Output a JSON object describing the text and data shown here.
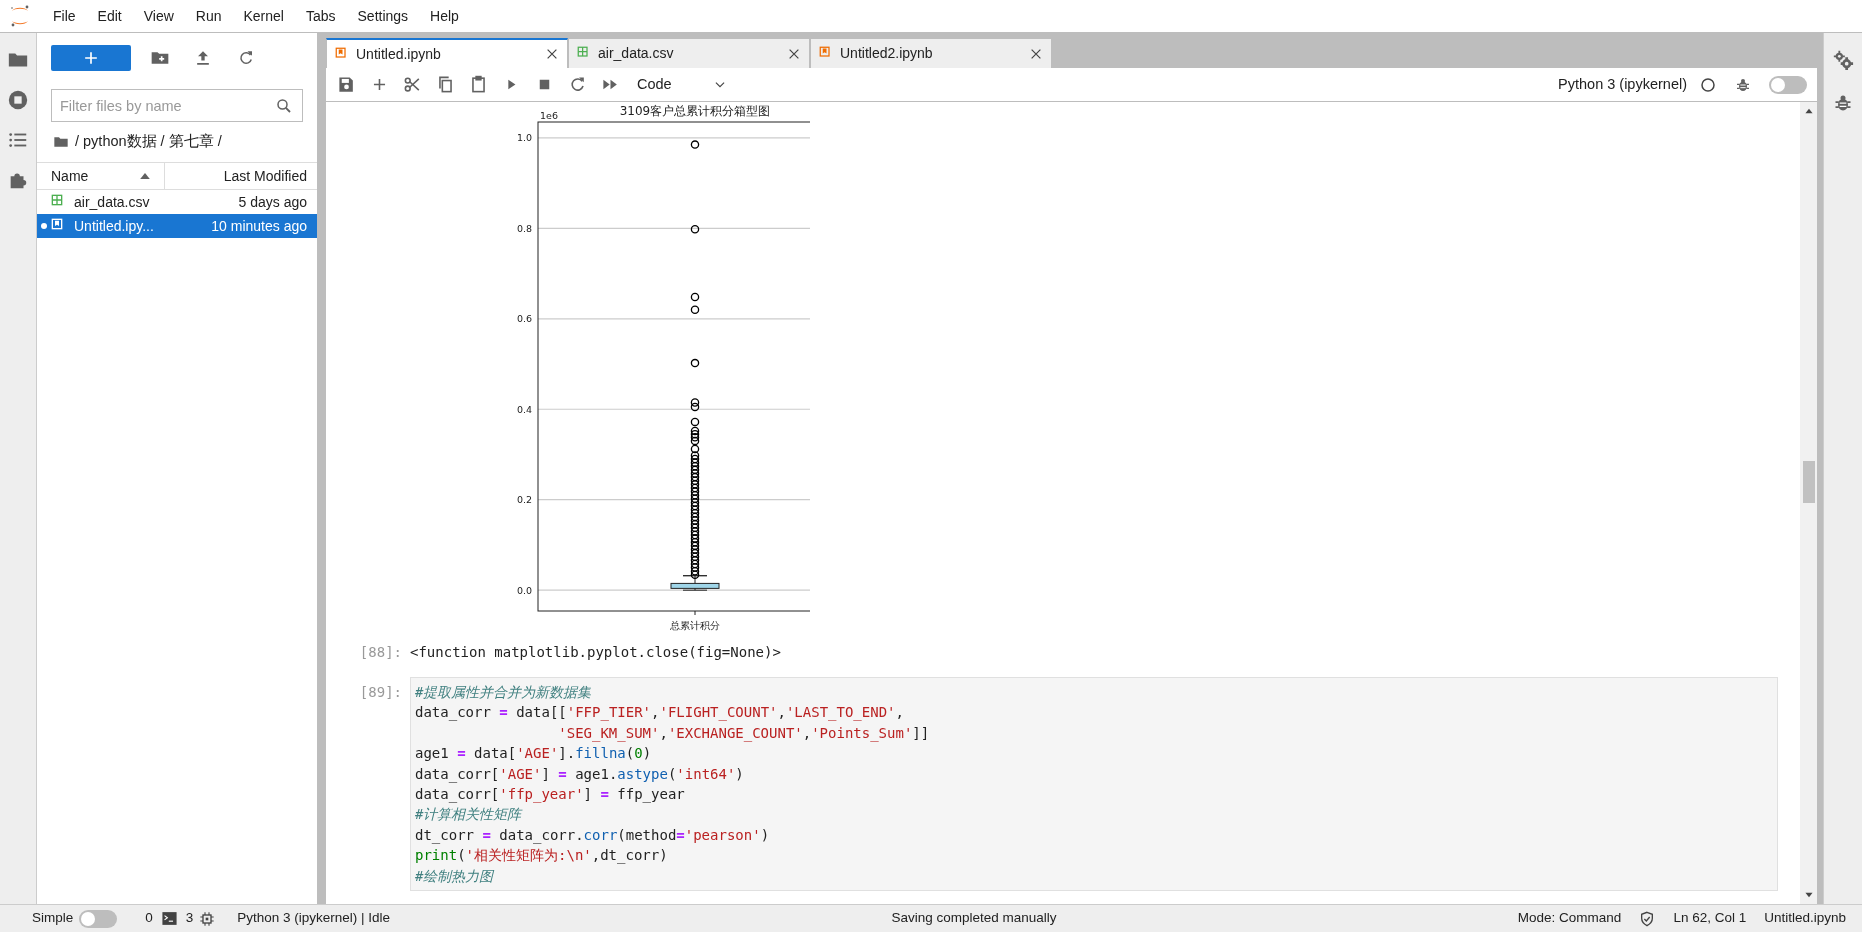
{
  "menu": [
    "File",
    "Edit",
    "View",
    "Run",
    "Kernel",
    "Tabs",
    "Settings",
    "Help"
  ],
  "file_browser": {
    "filter_placeholder": "Filter files by name",
    "breadcrumb": "/ python数据 / 第七章 /",
    "columns": [
      "Name",
      "Last Modified"
    ],
    "files": [
      {
        "name": "air_data.csv",
        "modified": "5 days ago",
        "kind": "csv",
        "selected": false,
        "running": false
      },
      {
        "name": "Untitled.ipy...",
        "modified": "10 minutes ago",
        "kind": "notebook",
        "selected": true,
        "running": true
      }
    ]
  },
  "tabs": [
    {
      "label": "Untitled.ipynb",
      "kind": "notebook",
      "selected": true
    },
    {
      "label": "air_data.csv",
      "kind": "csv",
      "selected": false
    },
    {
      "label": "Untitled2.ipynb",
      "kind": "notebook",
      "selected": false
    }
  ],
  "toolbar": {
    "cell_type": "Code",
    "kernel": "Python 3 (ipykernel)",
    "debugger_on": false
  },
  "output_chart": {
    "chart_data": {
      "type": "scatter",
      "title": "3109客户总累计积分箱型图",
      "ylabel": "1e6",
      "grid": true,
      "ylim": [
        -0.046,
        1.035
      ],
      "categories": [
        "总累计积分"
      ],
      "yticks": [
        {
          "value": 0,
          "label": "0.0"
        },
        {
          "value": 0.2,
          "label": "0.2"
        },
        {
          "value": 0.4,
          "label": "0.4"
        },
        {
          "value": 0.6,
          "label": "0.6"
        },
        {
          "value": 0.8,
          "label": "0.8"
        },
        {
          "value": 1,
          "label": "1.0"
        }
      ],
      "series": [
        {
          "color": "#000000",
          "values": [
            0.985
          ]
        },
        {
          "color": "#000000",
          "values": [
            0.798
          ]
        },
        {
          "color": "#000000",
          "values": [
            0.648
          ]
        },
        {
          "color": "#000000",
          "values": [
            0.62
          ]
        },
        {
          "color": "#000000",
          "values": [
            0.502
          ]
        },
        {
          "color": "#000000",
          "values": [
            0.415
          ]
        },
        {
          "color": "#000000",
          "values": [
            0.405
          ]
        },
        {
          "color": "#000000",
          "values": [
            0.372
          ]
        },
        {
          "color": "#000000",
          "values": [
            0.352
          ]
        },
        {
          "color": "#000000",
          "values": [
            0.345
          ]
        },
        {
          "color": "#000000",
          "values": [
            0.338
          ]
        },
        {
          "color": "#000000",
          "values": [
            0.33
          ]
        },
        {
          "color": "#000000",
          "values": [
            0.312
          ]
        },
        {
          "color": "#000000",
          "values": [
            0.298
          ]
        },
        {
          "color": "#000000",
          "values": [
            0.29
          ]
        },
        {
          "color": "#000000",
          "values": [
            0.282
          ]
        },
        {
          "color": "#000000",
          "values": [
            0.274
          ]
        },
        {
          "color": "#000000",
          "values": [
            0.266
          ]
        },
        {
          "color": "#000000",
          "values": [
            0.258
          ]
        },
        {
          "color": "#000000",
          "values": [
            0.25
          ]
        },
        {
          "color": "#000000",
          "values": [
            0.242
          ]
        },
        {
          "color": "#000000",
          "values": [
            0.234
          ]
        },
        {
          "color": "#000000",
          "values": [
            0.226
          ]
        },
        {
          "color": "#000000",
          "values": [
            0.218
          ]
        },
        {
          "color": "#000000",
          "values": [
            0.21
          ]
        },
        {
          "color": "#000000",
          "values": [
            0.202
          ]
        },
        {
          "color": "#000000",
          "values": [
            0.194
          ]
        },
        {
          "color": "#000000",
          "values": [
            0.186
          ]
        },
        {
          "color": "#000000",
          "values": [
            0.178
          ]
        },
        {
          "color": "#000000",
          "values": [
            0.17
          ]
        },
        {
          "color": "#000000",
          "values": [
            0.162
          ]
        },
        {
          "color": "#000000",
          "values": [
            0.154
          ]
        },
        {
          "color": "#000000",
          "values": [
            0.146
          ]
        },
        {
          "color": "#000000",
          "values": [
            0.138
          ]
        },
        {
          "color": "#000000",
          "values": [
            0.13
          ]
        },
        {
          "color": "#000000",
          "values": [
            0.122
          ]
        },
        {
          "color": "#000000",
          "values": [
            0.114
          ]
        },
        {
          "color": "#000000",
          "values": [
            0.106
          ]
        },
        {
          "color": "#000000",
          "values": [
            0.098
          ]
        },
        {
          "color": "#000000",
          "values": [
            0.09
          ]
        },
        {
          "color": "#000000",
          "values": [
            0.082
          ]
        },
        {
          "color": "#000000",
          "values": [
            0.074
          ]
        },
        {
          "color": "#000000",
          "values": [
            0.066
          ]
        },
        {
          "color": "#000000",
          "values": [
            0.058
          ]
        },
        {
          "color": "#000000",
          "values": [
            0.05
          ]
        },
        {
          "color": "#000000",
          "values": [
            0.042
          ]
        },
        {
          "color": "#000000",
          "values": [
            0.034
          ]
        }
      ],
      "bands": [
        {
          "axis": "y",
          "from": 0.004,
          "to": 0.015,
          "color": "#9fd5e8"
        }
      ]
    }
  },
  "cells": [
    {
      "kind": "output",
      "prompt": "[88]:",
      "text": "<function matplotlib.pyplot.close(fig=None)>"
    },
    {
      "kind": "code",
      "prompt": "[89]:",
      "lines": [
        [
          {
            "text": "#提取属性并合并为新数据集",
            "kind": "comment"
          }
        ],
        [
          {
            "text": "data_corr ",
            "kind": "plain"
          },
          {
            "text": "=",
            "kind": "op"
          },
          {
            "text": " data[[",
            "kind": "plain"
          },
          {
            "text": "'FFP_TIER'",
            "kind": "str"
          },
          {
            "text": ",",
            "kind": "plain"
          },
          {
            "text": "'FLIGHT_COUNT'",
            "kind": "str"
          },
          {
            "text": ",",
            "kind": "plain"
          },
          {
            "text": "'LAST_TO_END'",
            "kind": "str"
          },
          {
            "text": ",",
            "kind": "plain"
          }
        ],
        [
          {
            "text": "                 'SEG_KM_SUM'",
            "kind": "str"
          },
          {
            "text": ",",
            "kind": "plain"
          },
          {
            "text": "'EXCHANGE_COUNT'",
            "kind": "str"
          },
          {
            "text": ",",
            "kind": "plain"
          },
          {
            "text": "'Points_Sum'",
            "kind": "str"
          },
          {
            "text": "]]",
            "kind": "plain"
          }
        ],
        [
          {
            "text": "age1 ",
            "kind": "plain"
          },
          {
            "text": "=",
            "kind": "op"
          },
          {
            "text": " data[",
            "kind": "plain"
          },
          {
            "text": "'AGE'",
            "kind": "str"
          },
          {
            "text": "].",
            "kind": "plain"
          },
          {
            "text": "fillna",
            "kind": "func"
          },
          {
            "text": "(",
            "kind": "plain"
          },
          {
            "text": "0",
            "kind": "num"
          },
          {
            "text": ")",
            "kind": "plain"
          }
        ],
        [
          {
            "text": "data_corr[",
            "kind": "plain"
          },
          {
            "text": "'AGE'",
            "kind": "str"
          },
          {
            "text": "] ",
            "kind": "plain"
          },
          {
            "text": "=",
            "kind": "op"
          },
          {
            "text": " age1.",
            "kind": "plain"
          },
          {
            "text": "astype",
            "kind": "func"
          },
          {
            "text": "(",
            "kind": "plain"
          },
          {
            "text": "'int64'",
            "kind": "str"
          },
          {
            "text": ")",
            "kind": "plain"
          }
        ],
        [
          {
            "text": "data_corr[",
            "kind": "plain"
          },
          {
            "text": "'ffp_year'",
            "kind": "str"
          },
          {
            "text": "] ",
            "kind": "plain"
          },
          {
            "text": "=",
            "kind": "op"
          },
          {
            "text": " ffp_year",
            "kind": "plain"
          }
        ],
        [
          {
            "text": "#计算相关性矩阵",
            "kind": "comment"
          }
        ],
        [
          {
            "text": "dt_corr ",
            "kind": "plain"
          },
          {
            "text": "=",
            "kind": "op"
          },
          {
            "text": " data_corr.",
            "kind": "plain"
          },
          {
            "text": "corr",
            "kind": "func"
          },
          {
            "text": "(method",
            "kind": "plain"
          },
          {
            "text": "=",
            "kind": "op"
          },
          {
            "text": "'pearson'",
            "kind": "str"
          },
          {
            "text": ")",
            "kind": "plain"
          }
        ],
        [
          {
            "text": "print",
            "kind": "builtin"
          },
          {
            "text": "(",
            "kind": "plain"
          },
          {
            "text": "'相关性矩阵为:\\n'",
            "kind": "str"
          },
          {
            "text": ",dt_corr)",
            "kind": "plain"
          }
        ],
        [
          {
            "text": "#绘制热力图",
            "kind": "comment"
          }
        ]
      ]
    }
  ],
  "status_bar": {
    "simple_label": "Simple",
    "simple_on": false,
    "terminals": "0",
    "kernels": "3",
    "kernel_status": "Python 3 (ipykernel) | Idle",
    "message": "Saving completed manually",
    "mode": "Mode: Command",
    "position": "Ln 62, Col 1",
    "file": "Untitled.ipynb"
  }
}
